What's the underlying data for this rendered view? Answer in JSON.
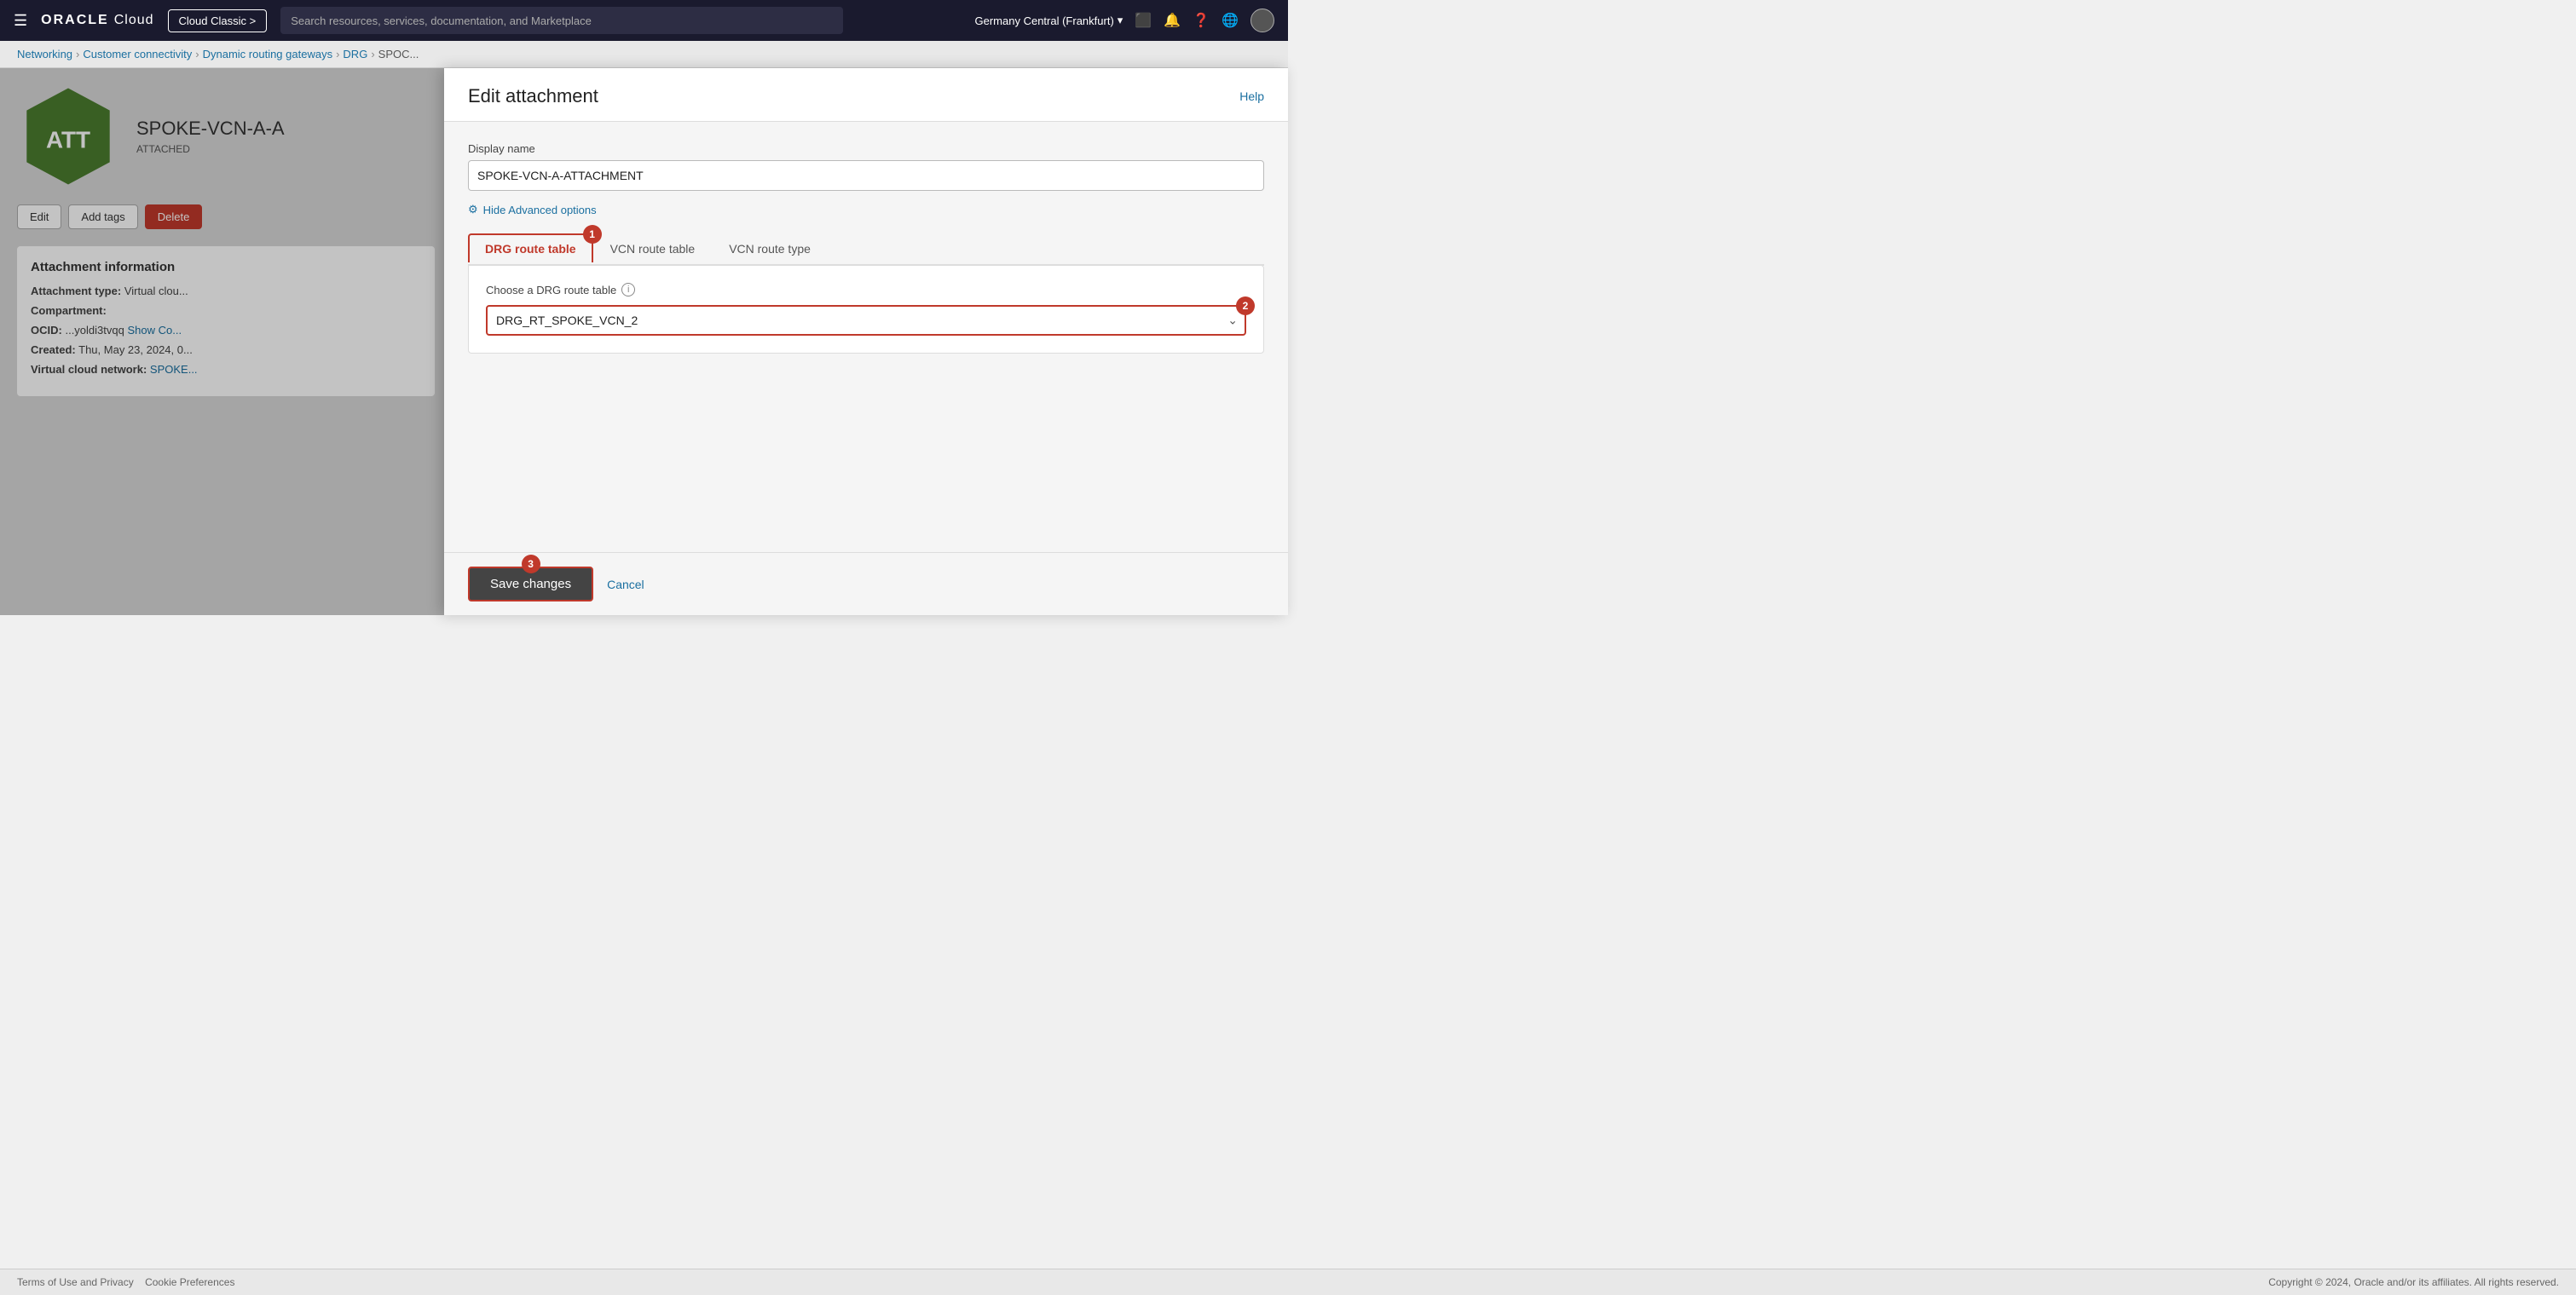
{
  "topbar": {
    "hamburger_icon": "☰",
    "oracle_text": "ORACLE",
    "cloud_text": "Cloud",
    "cloud_classic_label": "Cloud Classic >",
    "search_placeholder": "Search resources, services, documentation, and Marketplace",
    "region_label": "Germany Central (Frankfurt)",
    "chevron_down": "⌄",
    "help_icon": "?",
    "globe_icon": "🌐",
    "notifications_icon": "🔔",
    "screen_icon": "⬜"
  },
  "breadcrumb": {
    "networking": "Networking",
    "customer_connectivity": "Customer connectivity",
    "dynamic_routing_gateways": "Dynamic routing gateways",
    "drg": "DRG",
    "spoke": "SPOC...",
    "sep": "›"
  },
  "left_panel": {
    "resource_title": "SPOKE-VCN-A-A",
    "resource_badge": "ATTACHED",
    "hex_label": "ATT",
    "edit_label": "Edit",
    "add_tags_label": "Add tags",
    "delete_label": "Delete",
    "info_section_title": "Attachment information",
    "attachment_type_label": "Attachment type:",
    "attachment_type_value": "Virtual clou...",
    "compartment_label": "Compartment:",
    "compartment_value": "",
    "ocid_label": "OCID:",
    "ocid_value": "...yoldi3tvqq",
    "show_label": "Show",
    "copy_label": "Co...",
    "created_label": "Created:",
    "created_value": "Thu, May 23, 2024, 0...",
    "vcn_label": "Virtual cloud network:",
    "vcn_value": "SPOKE..."
  },
  "modal": {
    "title": "Edit attachment",
    "help_label": "Help",
    "display_name_label": "Display name",
    "display_name_value": "SPOKE-VCN-A-ATTACHMENT",
    "advanced_options_label": "Hide Advanced options",
    "tabs": [
      {
        "id": "drg-route-table",
        "label": "DRG route table",
        "active": true
      },
      {
        "id": "vcn-route-table",
        "label": "VCN route table",
        "active": false
      },
      {
        "id": "vcn-route-type",
        "label": "VCN route type",
        "active": false
      }
    ],
    "choose_drg_label": "Choose a DRG route table",
    "drg_route_value": "DRG_RT_SPOKE_VCN_2",
    "save_label": "Save changes",
    "cancel_label": "Cancel"
  },
  "footer": {
    "terms_label": "Terms of Use and Privacy",
    "cookie_label": "Cookie Preferences",
    "copyright": "Copyright © 2024, Oracle and/or its affiliates. All rights reserved."
  },
  "badges": {
    "one": "1",
    "two": "2",
    "three": "3"
  }
}
